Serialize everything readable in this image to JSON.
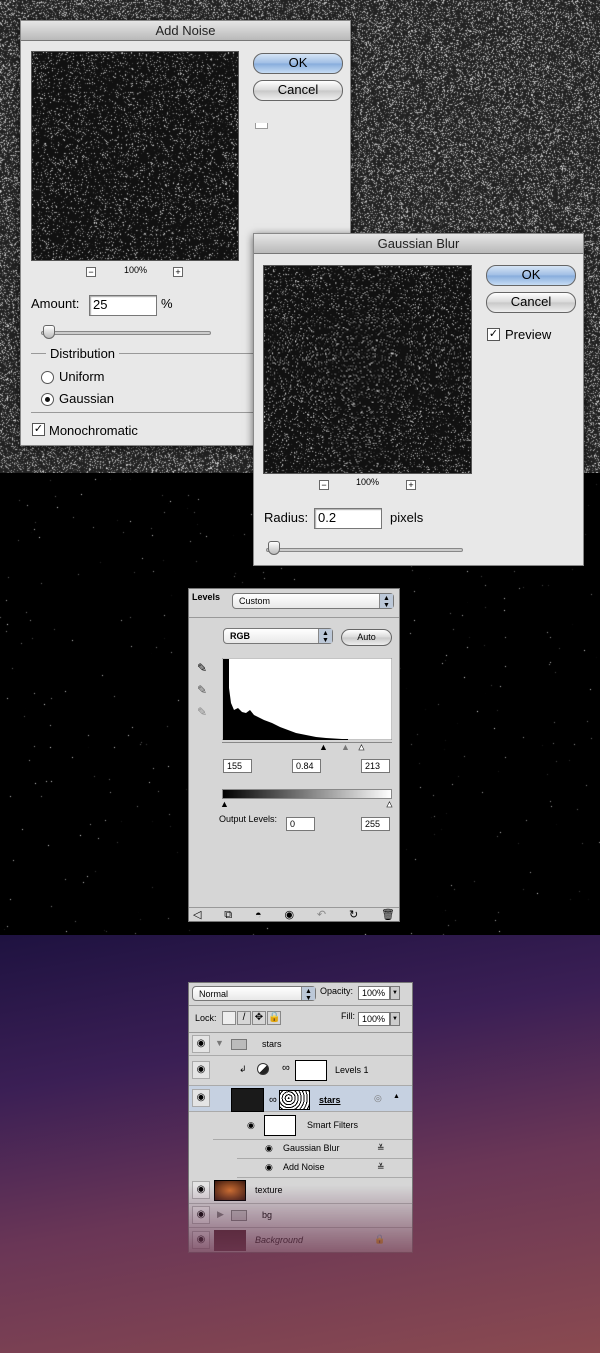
{
  "add_noise": {
    "title": "Add Noise",
    "ok": "OK",
    "cancel": "Cancel",
    "zoom": "100%",
    "zoom_out": "−",
    "zoom_in": "+",
    "amount_label": "Amount:",
    "amount_value": "25",
    "amount_unit": "%",
    "amount_slider_fraction": 0.06,
    "distribution_label": "Distribution",
    "uniform": "Uniform",
    "gaussian": "Gaussian",
    "distribution_selected": "Gaussian",
    "monochromatic": "Monochromatic",
    "monochromatic_checked": true
  },
  "gaussian_blur": {
    "title": "Gaussian Blur",
    "ok": "OK",
    "cancel": "Cancel",
    "preview": "Preview",
    "preview_checked": true,
    "zoom": "100%",
    "zoom_out": "−",
    "zoom_in": "+",
    "radius_label": "Radius:",
    "radius_value": "0.2",
    "radius_unit": "pixels"
  },
  "levels": {
    "title": "Levels",
    "preset": "Custom",
    "channel": "RGB",
    "auto": "Auto",
    "input_black": "155",
    "input_gamma": "0.84",
    "input_white": "213",
    "output_label": "Output Levels:",
    "output_black": "0",
    "output_white": "255"
  },
  "layers": {
    "blend_mode": "Normal",
    "opacity_label": "Opacity:",
    "opacity": "100%",
    "lock_label": "Lock:",
    "fill_label": "Fill:",
    "fill": "100%",
    "items": [
      {
        "name": "stars",
        "type": "group"
      },
      {
        "name": "Levels 1",
        "type": "adjustment"
      },
      {
        "name": "stars",
        "type": "smart-object"
      },
      {
        "name": "Smart Filters",
        "type": "smart-filters"
      },
      {
        "name": "Gaussian Blur",
        "type": "filter"
      },
      {
        "name": "Add Noise",
        "type": "filter"
      },
      {
        "name": "texture",
        "type": "layer"
      },
      {
        "name": "bg",
        "type": "group"
      },
      {
        "name": "Background",
        "type": "background"
      }
    ]
  }
}
